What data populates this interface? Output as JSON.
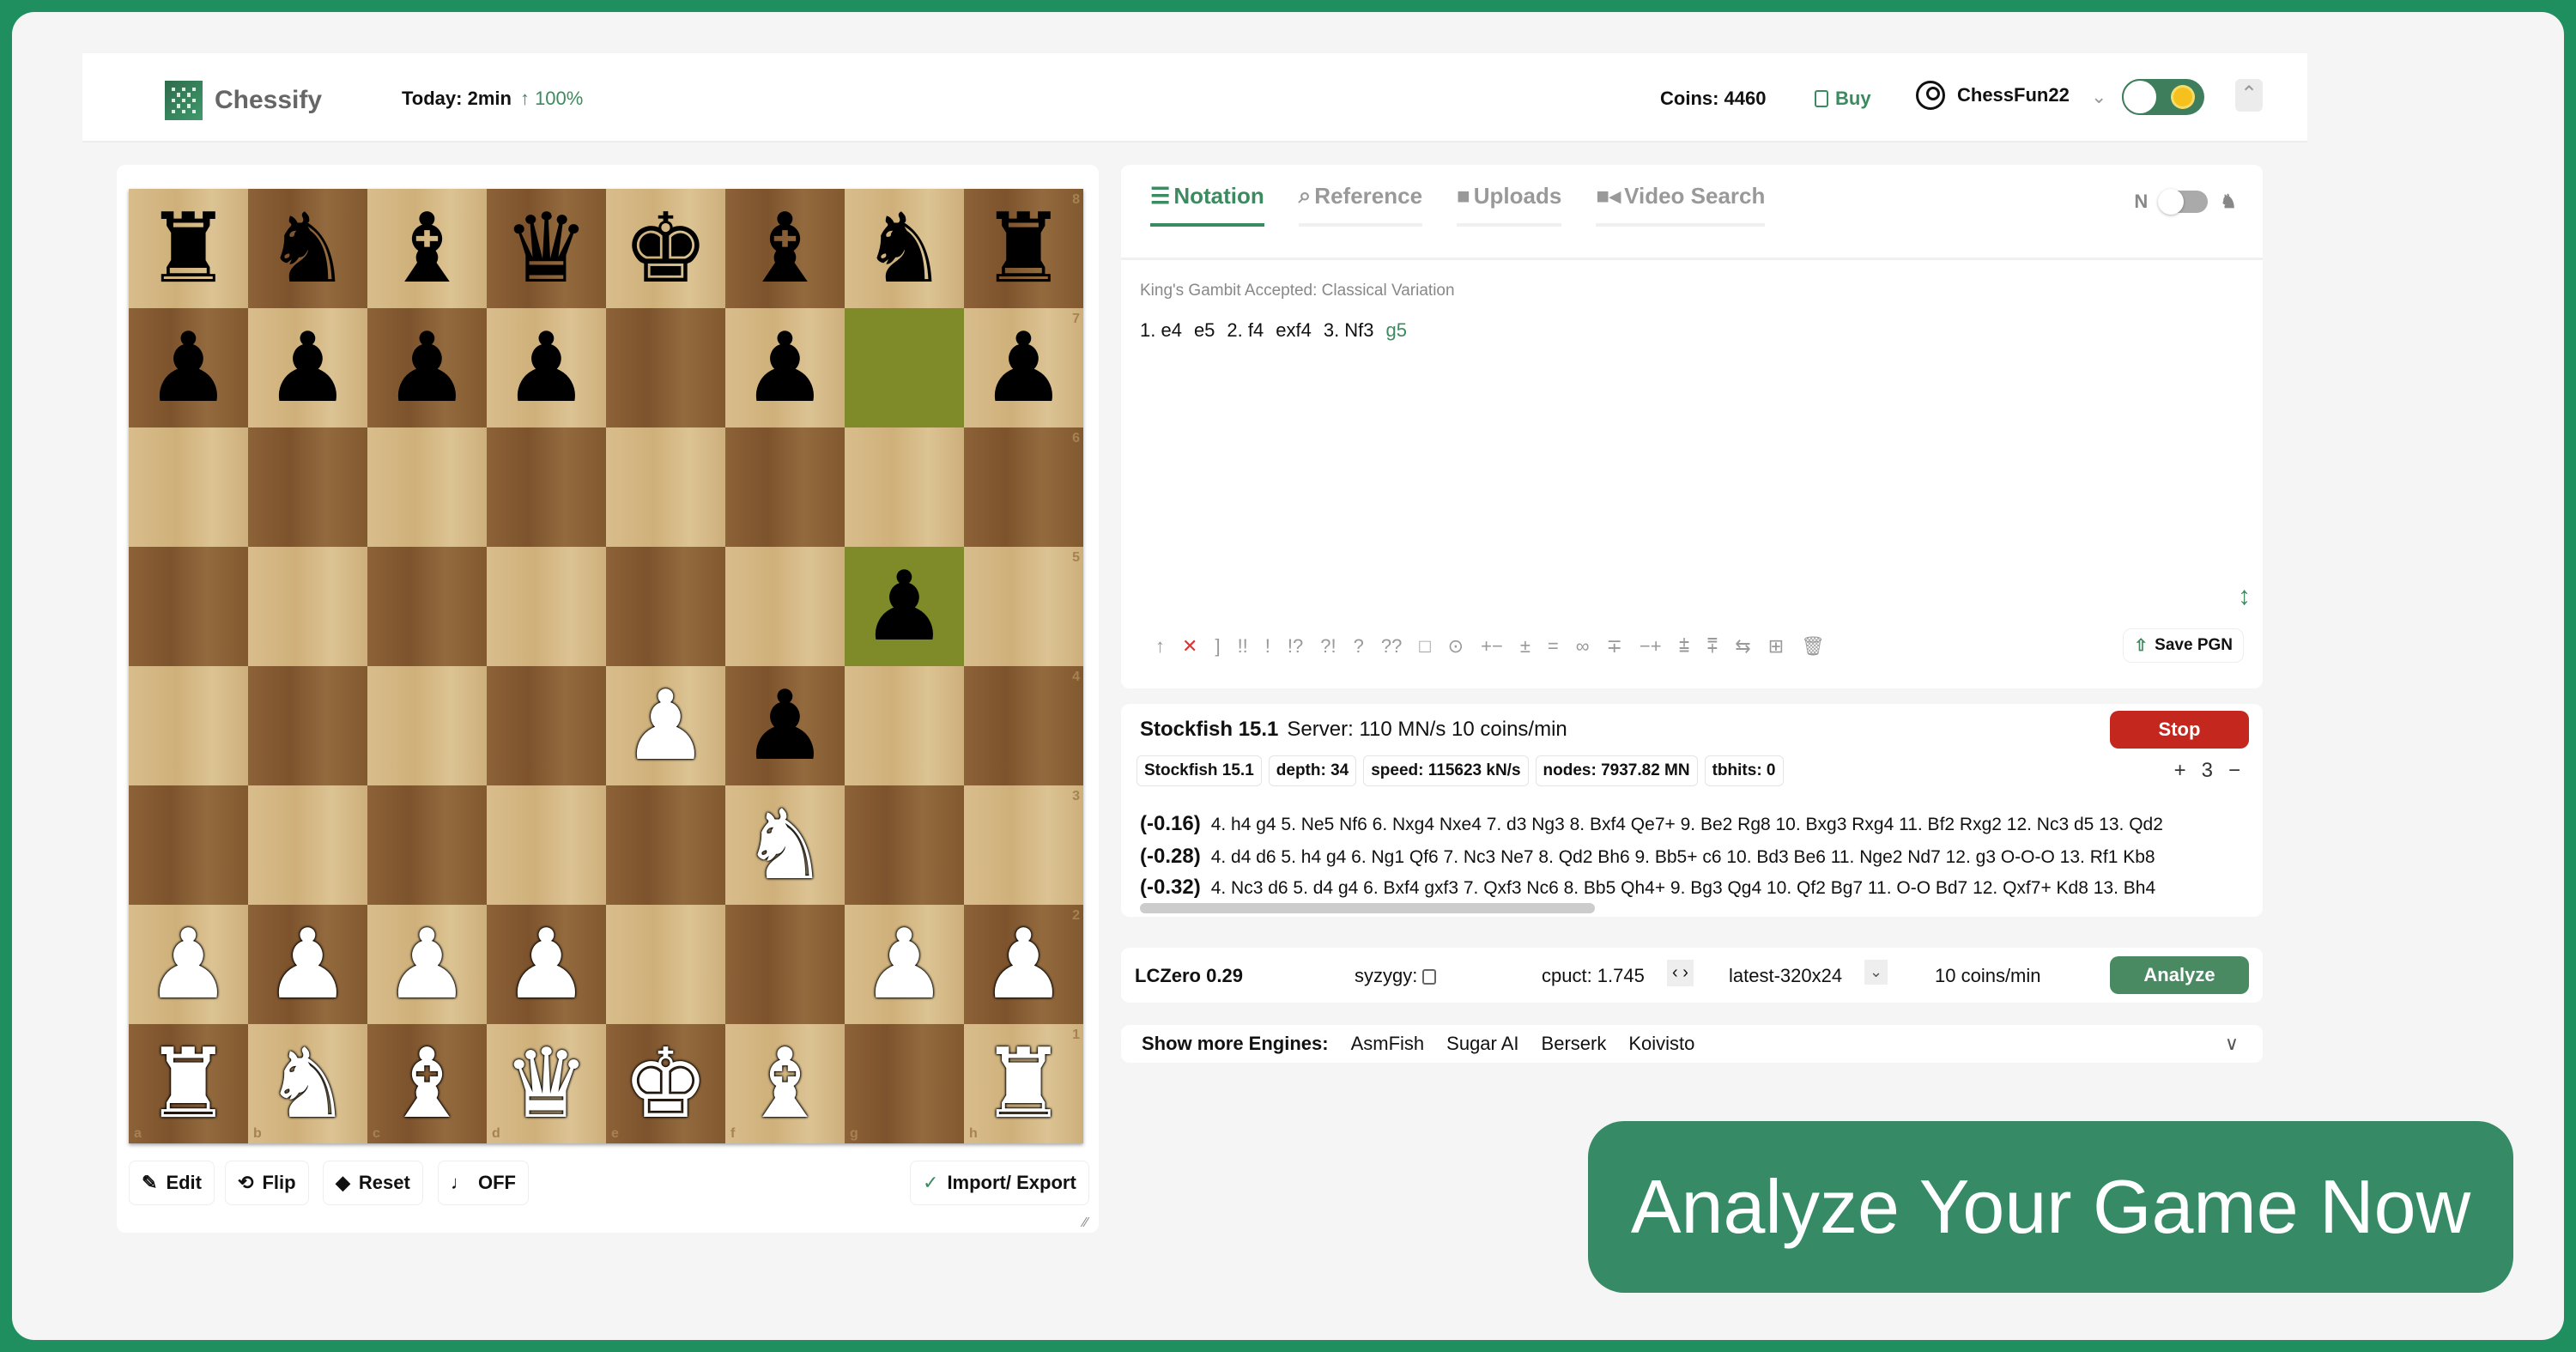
{
  "header": {
    "brand": "Chessify",
    "today_label": "Today: 2min",
    "today_change": "↑ 100%",
    "coins": "Coins: 4460",
    "buy": "Buy",
    "username": "ChessFun22",
    "chevron": "⌄",
    "collapse": "⌃"
  },
  "board": {
    "files": [
      "a",
      "b",
      "c",
      "d",
      "e",
      "f",
      "g",
      "h"
    ],
    "ranks": [
      "8",
      "7",
      "6",
      "5",
      "4",
      "3",
      "2",
      "1"
    ],
    "position": [
      [
        "br",
        "bn",
        "bb",
        "bq",
        "bk",
        "bb",
        "bn",
        "br"
      ],
      [
        "bp",
        "bp",
        "bp",
        "bp",
        "",
        "bp",
        "",
        "bp"
      ],
      [
        "",
        "",
        "",
        "",
        "",
        "",
        "",
        ""
      ],
      [
        "",
        "",
        "",
        "",
        "",
        "",
        "bp",
        ""
      ],
      [
        "",
        "",
        "",
        "",
        "wp",
        "bp",
        "",
        ""
      ],
      [
        "",
        "",
        "",
        "",
        "",
        "wn",
        "",
        ""
      ],
      [
        "wp",
        "wp",
        "wp",
        "wp",
        "",
        "",
        "wp",
        "wp"
      ],
      [
        "wr",
        "wn",
        "wb",
        "wq",
        "wk",
        "wb",
        "",
        "wr"
      ]
    ],
    "highlights": [
      "g7",
      "g5"
    ],
    "buttons": {
      "edit": "Edit",
      "flip": "Flip",
      "reset": "Reset",
      "sound": "OFF",
      "import_export": "Import/ Export"
    }
  },
  "notation": {
    "tabs": [
      "Notation",
      "Reference",
      "Uploads",
      "Video Search"
    ],
    "active_tab": "Notation",
    "toggle_label": "N",
    "opening": "King's Gambit Accepted: Classical Variation",
    "moves": [
      "1. e4",
      "e5",
      "2. f4",
      "exf4",
      "3. Nf3",
      "g5"
    ],
    "current_move": "g5",
    "annotations": [
      "↑",
      "✕",
      "]",
      "!!",
      "!",
      "!?",
      "?!",
      "?",
      "??",
      "□",
      "⊙",
      "+−",
      "±",
      "=",
      "∞",
      "∓",
      "−+",
      "⩲",
      "⩱",
      "⇆",
      "⊞",
      "🗑"
    ],
    "save_pgn": "Save PGN"
  },
  "engine": {
    "title": "Stockfish 15.1",
    "server": "Server: 110 MN/s  10 coins/min",
    "stop": "Stop",
    "stats": [
      "Stockfish 15.1",
      "depth: 34",
      "speed: 115623 kN/s",
      "nodes: 7937.82 MN",
      "tbhits: 0"
    ],
    "lines_count": "3",
    "plus": "+",
    "minus": "−",
    "lines": [
      {
        "eval": "(-0.16)",
        "moves": "4. h4 g4 5. Ne5 Nf6 6. Nxg4 Nxe4 7. d3 Ng3 8. Bxf4 Qe7+ 9. Be2 Rg8 10. Bxg3 Rxg4 11. Bf2 Rxg2 12. Nc3 d5 13. Qd2"
      },
      {
        "eval": "(-0.28)",
        "moves": "4. d4 d6 5. h4 g4 6. Ng1 Qf6 7. Nc3 Ne7 8. Qd2 Bh6 9. Bb5+ c6 10. Bd3 Be6 11. Nge2 Nd7 12. g3 O-O-O 13. Rf1 Kb8"
      },
      {
        "eval": "(-0.32)",
        "moves": "4. Nc3 d6 5. d4 g4 6. Bxf4 gxf3 7. Qxf3 Nc6 8. Bb5 Qh4+ 9. Bg3 Qg4 10. Qf2 Bg7 11. O-O Bd7 12. Qxf7+ Kd8 13. Bh4"
      }
    ]
  },
  "lczero": {
    "name": "LCZero 0.29",
    "syzygy": "syzygy:",
    "cpuct": "cpuct: 1.745",
    "arrows": "‹ ›",
    "network": "latest-320x24",
    "netdrop": "⌄",
    "cost": "10 coins/min",
    "analyze": "Analyze"
  },
  "more_engines": {
    "label": "Show more Engines:",
    "engines": [
      "AsmFish",
      "Sugar AI",
      "Berserk",
      "Koivisto"
    ],
    "dropdown": "∨"
  },
  "cta": "Analyze Your Game Now"
}
